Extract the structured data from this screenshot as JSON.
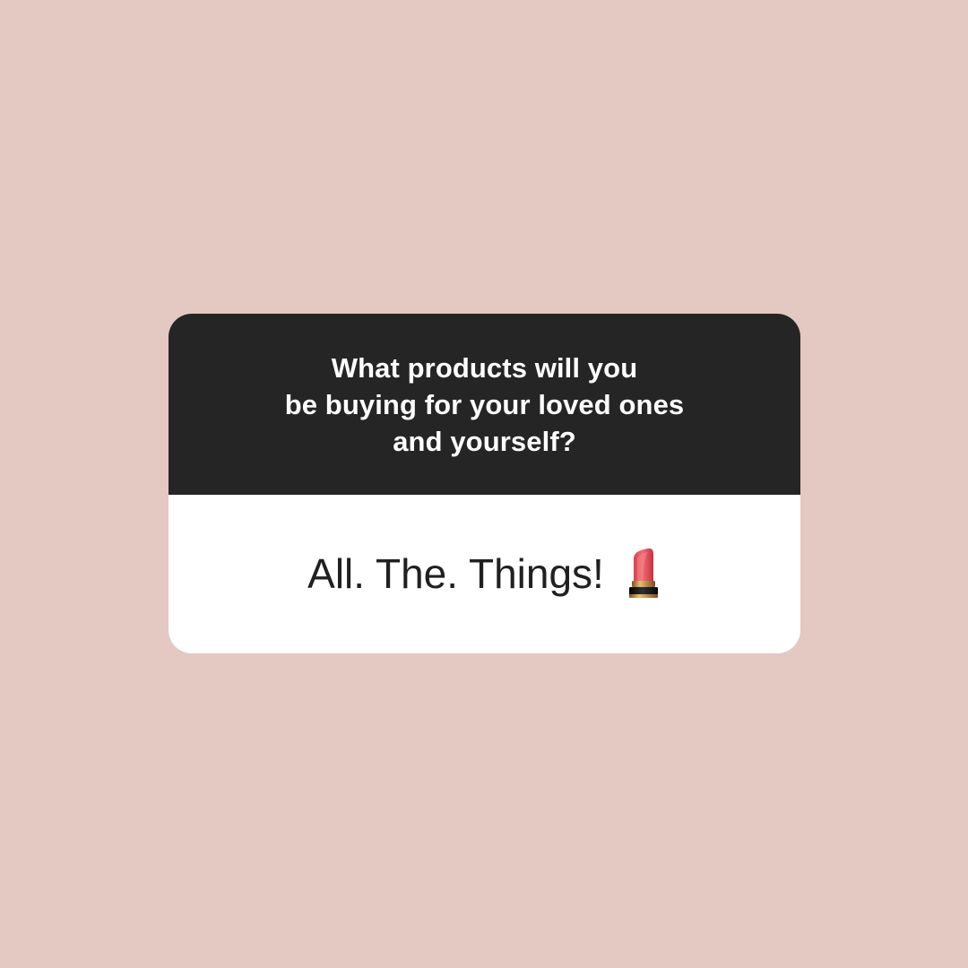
{
  "colors": {
    "background": "#e4c8c2",
    "question_panel": "#252525",
    "answer_panel": "#ffffff",
    "question_text": "#ffffff",
    "answer_text": "#202020",
    "lipstick_bullet": "#e65d66",
    "lipstick_tube": "#c99a52",
    "lipstick_base": "#181818"
  },
  "card": {
    "question_lines": [
      "What products will you",
      "be buying for your loved ones",
      "and yourself?"
    ],
    "answer": "All. The. Things!",
    "answer_icon": "lipstick-icon"
  }
}
